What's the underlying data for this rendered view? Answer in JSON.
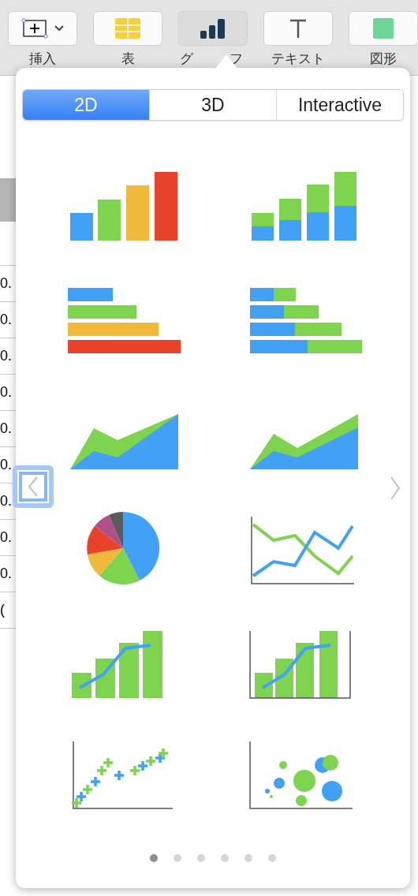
{
  "toolbar": {
    "buttons": [
      {
        "kind": "insert",
        "label": "挿入"
      },
      {
        "kind": "table",
        "label": "表"
      },
      {
        "kind": "chart",
        "label_parts": [
          "グ",
          "フ"
        ]
      },
      {
        "kind": "text",
        "label": "テキスト"
      },
      {
        "kind": "shape",
        "label": "図形"
      }
    ]
  },
  "sheet": {
    "cells": [
      "0.",
      "0.",
      "0.",
      "0.",
      "0.",
      "0.",
      "0.",
      "0.",
      "0.",
      "("
    ]
  },
  "popover": {
    "tabs": [
      {
        "label": "2D",
        "selected": true
      },
      {
        "label": "3D",
        "selected": false
      },
      {
        "label": "Interactive",
        "selected": false
      }
    ],
    "charts": [
      {
        "kind": "bar"
      },
      {
        "kind": "stacked-bar"
      },
      {
        "kind": "hbar"
      },
      {
        "kind": "stacked-hbar"
      },
      {
        "kind": "area"
      },
      {
        "kind": "stacked-area"
      },
      {
        "kind": "pie"
      },
      {
        "kind": "line"
      },
      {
        "kind": "bar-line"
      },
      {
        "kind": "bar-line-axes"
      },
      {
        "kind": "scatter"
      },
      {
        "kind": "bubble"
      }
    ],
    "pages": [
      {
        "selected": true
      },
      {
        "selected": false
      },
      {
        "selected": false
      },
      {
        "selected": false
      },
      {
        "selected": false
      },
      {
        "selected": false
      }
    ]
  }
}
